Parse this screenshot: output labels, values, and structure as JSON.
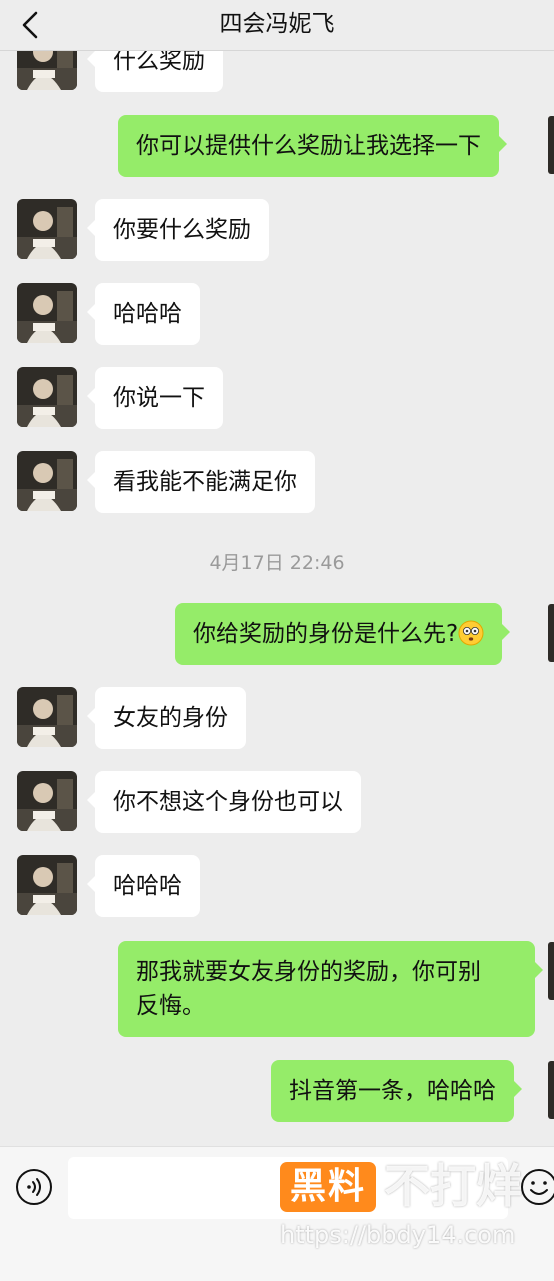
{
  "header": {
    "title": "四会冯妮飞",
    "back_icon": "back-chevron-icon"
  },
  "messages": [
    {
      "side": "in",
      "text": "什么奖励"
    },
    {
      "side": "out",
      "text": "你可以提供什么奖励让我选择一下"
    },
    {
      "side": "in",
      "text": "你要什么奖励"
    },
    {
      "side": "in",
      "text": "哈哈哈"
    },
    {
      "side": "in",
      "text": "你说一下"
    },
    {
      "side": "in",
      "text": "看我能不能满足你"
    },
    {
      "side": "time",
      "text": "4月17日 22:46"
    },
    {
      "side": "out",
      "text": "你给奖励的身份是什么先?"
    },
    {
      "side": "in",
      "text": "女友的身份"
    },
    {
      "side": "in",
      "text": "你不想这个身份也可以"
    },
    {
      "side": "in",
      "text": "哈哈哈"
    },
    {
      "side": "out",
      "text_line1": "那我就要女友身份的奖励，你可别",
      "text_line2": "反悔。"
    },
    {
      "side": "out",
      "text": "抖音第一条，哈哈哈"
    }
  ],
  "input_bar": {
    "voice_icon": "voice-icon",
    "emoji_icon": "emoji-icon",
    "placeholder": ""
  },
  "watermark": {
    "logo_text": "黑料",
    "slogan": "不打烊",
    "url": "https://bbdy14.com"
  },
  "colors": {
    "background": "#ededed",
    "bubble_in": "#ffffff",
    "bubble_out": "#95ec69",
    "watermark_orange": "#ff8a1c"
  }
}
